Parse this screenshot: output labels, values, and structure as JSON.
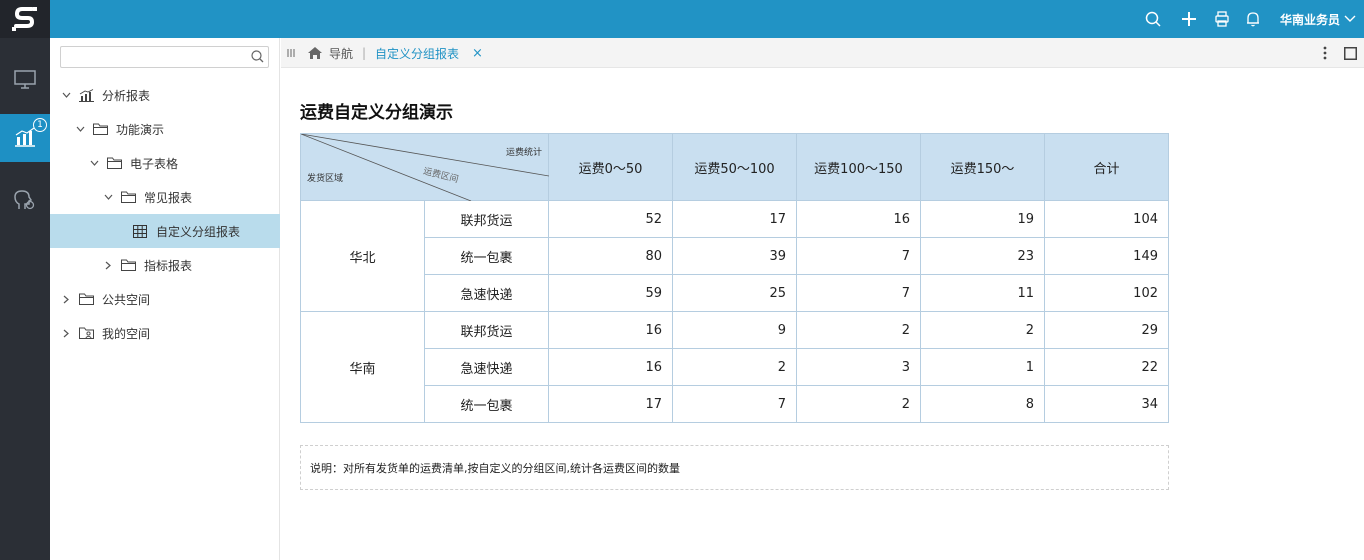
{
  "topbar": {
    "user_name": "华南业务员",
    "accent_color": "#2193c5"
  },
  "rail": {
    "items": [
      {
        "icon": "monitor-icon"
      },
      {
        "icon": "analytics-chart-icon",
        "badge": "1",
        "active": true
      },
      {
        "icon": "brain-gear-icon"
      }
    ]
  },
  "tree": {
    "search_placeholder": "",
    "nodes": [
      {
        "label": "分析报表",
        "icon": "bar-chart-icon",
        "expanded": true
      },
      {
        "label": "功能演示",
        "icon": "folder-icon",
        "expanded": true
      },
      {
        "label": "电子表格",
        "icon": "folder-icon",
        "expanded": true
      },
      {
        "label": "常见报表",
        "icon": "folder-icon",
        "expanded": true
      },
      {
        "label": "自定义分组报表",
        "icon": "grid-table-icon",
        "selected": true
      },
      {
        "label": "指标报表",
        "icon": "folder-icon",
        "expanded": false
      },
      {
        "label": "公共空间",
        "icon": "folder-icon",
        "expanded": false
      },
      {
        "label": "我的空间",
        "icon": "user-folder-icon",
        "expanded": false
      }
    ]
  },
  "tabs": {
    "home_label": "导航",
    "active_tab": "自定义分组报表"
  },
  "report": {
    "title": "运费自定义分组演示",
    "corner": {
      "top_right": "运费统计",
      "middle": "运费区间",
      "bottom_left": "发货区域"
    },
    "columns": [
      "运费0～50",
      "运费50～100",
      "运费100～150",
      "运费150～",
      "合计"
    ],
    "groups": [
      {
        "region": "华北",
        "rows": [
          {
            "carrier": "联邦货运",
            "values": [
              "52",
              "17",
              "16",
              "19",
              "104"
            ]
          },
          {
            "carrier": "统一包裹",
            "values": [
              "80",
              "39",
              "7",
              "23",
              "149"
            ]
          },
          {
            "carrier": "急速快递",
            "values": [
              "59",
              "25",
              "7",
              "11",
              "102"
            ]
          }
        ]
      },
      {
        "region": "华南",
        "rows": [
          {
            "carrier": "联邦货运",
            "values": [
              "16",
              "9",
              "2",
              "2",
              "29"
            ]
          },
          {
            "carrier": "急速快递",
            "values": [
              "16",
              "2",
              "3",
              "1",
              "22"
            ]
          },
          {
            "carrier": "统一包裹",
            "values": [
              "17",
              "7",
              "2",
              "8",
              "34"
            ]
          }
        ]
      }
    ],
    "note": "说明：对所有发货单的运费清单,按自定义的分组区间,统计各运费区间的数量"
  }
}
